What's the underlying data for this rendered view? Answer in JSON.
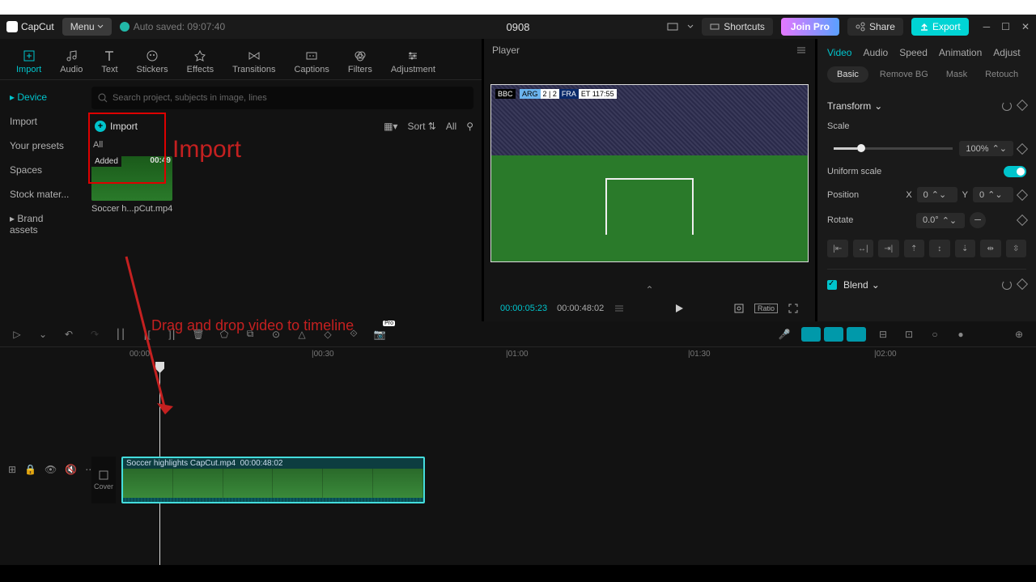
{
  "titlebar": {
    "app": "CapCut",
    "menu": "Menu",
    "autosave": "Auto saved: 09:07:40",
    "project": "0908",
    "shortcuts": "Shortcuts",
    "joinpro": "Join Pro",
    "share": "Share",
    "export": "Export"
  },
  "topTabs": [
    "Import",
    "Audio",
    "Text",
    "Stickers",
    "Effects",
    "Transitions",
    "Captions",
    "Filters",
    "Adjustment"
  ],
  "sideNav": [
    "Device",
    "Import",
    "Your presets",
    "Spaces",
    "Stock mater...",
    "Brand assets"
  ],
  "media": {
    "searchPlaceholder": "Search project, subjects in image, lines",
    "importLabel": "Import",
    "sort": "Sort",
    "all": "All",
    "chipAll": "All",
    "thumbAdded": "Added",
    "thumbDur": "00:49",
    "thumbName": "Soccer h...pCut.mp4"
  },
  "annotations": {
    "importLabel": "Import",
    "dragLabel": "Drag and drop video to timeline"
  },
  "player": {
    "title": "Player",
    "bbc": "BBC",
    "scoreA": "ARG",
    "scoreMid": "2 | 2",
    "scoreB": "FRA",
    "scoreTime": "ET 117:55",
    "current": "00:00:05:23",
    "total": "00:00:48:02"
  },
  "props": {
    "tabs": [
      "Video",
      "Audio",
      "Speed",
      "Animation",
      "Adjust"
    ],
    "subtabs": [
      "Basic",
      "Remove BG",
      "Mask",
      "Retouch"
    ],
    "transform": "Transform",
    "scale": "Scale",
    "scaleVal": "100%",
    "uniform": "Uniform scale",
    "position": "Position",
    "xLabel": "X",
    "xVal": "0",
    "yLabel": "Y",
    "yVal": "0",
    "rotate": "Rotate",
    "rotateVal": "0.0°",
    "blend": "Blend"
  },
  "timeline": {
    "ruler": [
      "00:00",
      "|00:30",
      "|01:00",
      "|01:30",
      "|02:00"
    ],
    "cover": "Cover",
    "clipName": "Soccer highlights CapCut.mp4",
    "clipDur": "00:00:48:02"
  }
}
